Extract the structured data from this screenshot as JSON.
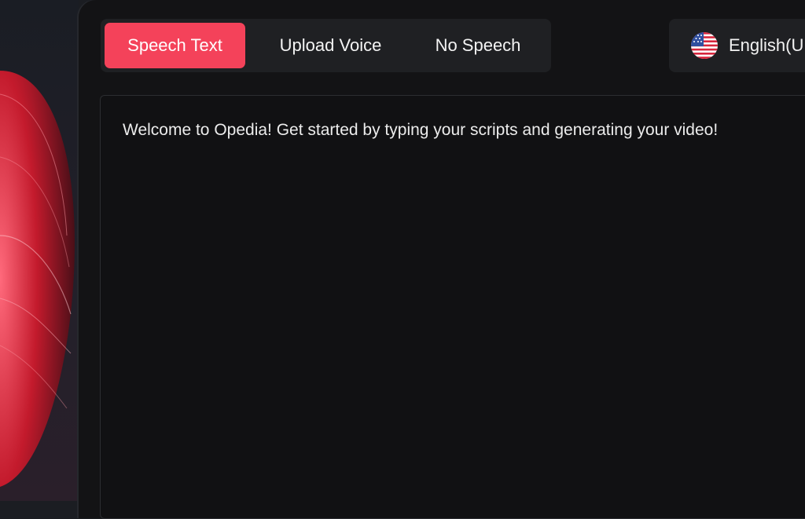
{
  "tabs": [
    {
      "label": "Speech Text",
      "active": true
    },
    {
      "label": "Upload Voice",
      "active": false
    },
    {
      "label": "No Speech",
      "active": false
    }
  ],
  "language": {
    "label": "English(U",
    "icon": "us-flag-icon"
  },
  "editor": {
    "text": "Welcome to Opedia! Get started by typing your scripts and generating your video!"
  },
  "colors": {
    "accent": "#f4425a",
    "panel": "#131315",
    "tab_bar": "#1f2023"
  }
}
